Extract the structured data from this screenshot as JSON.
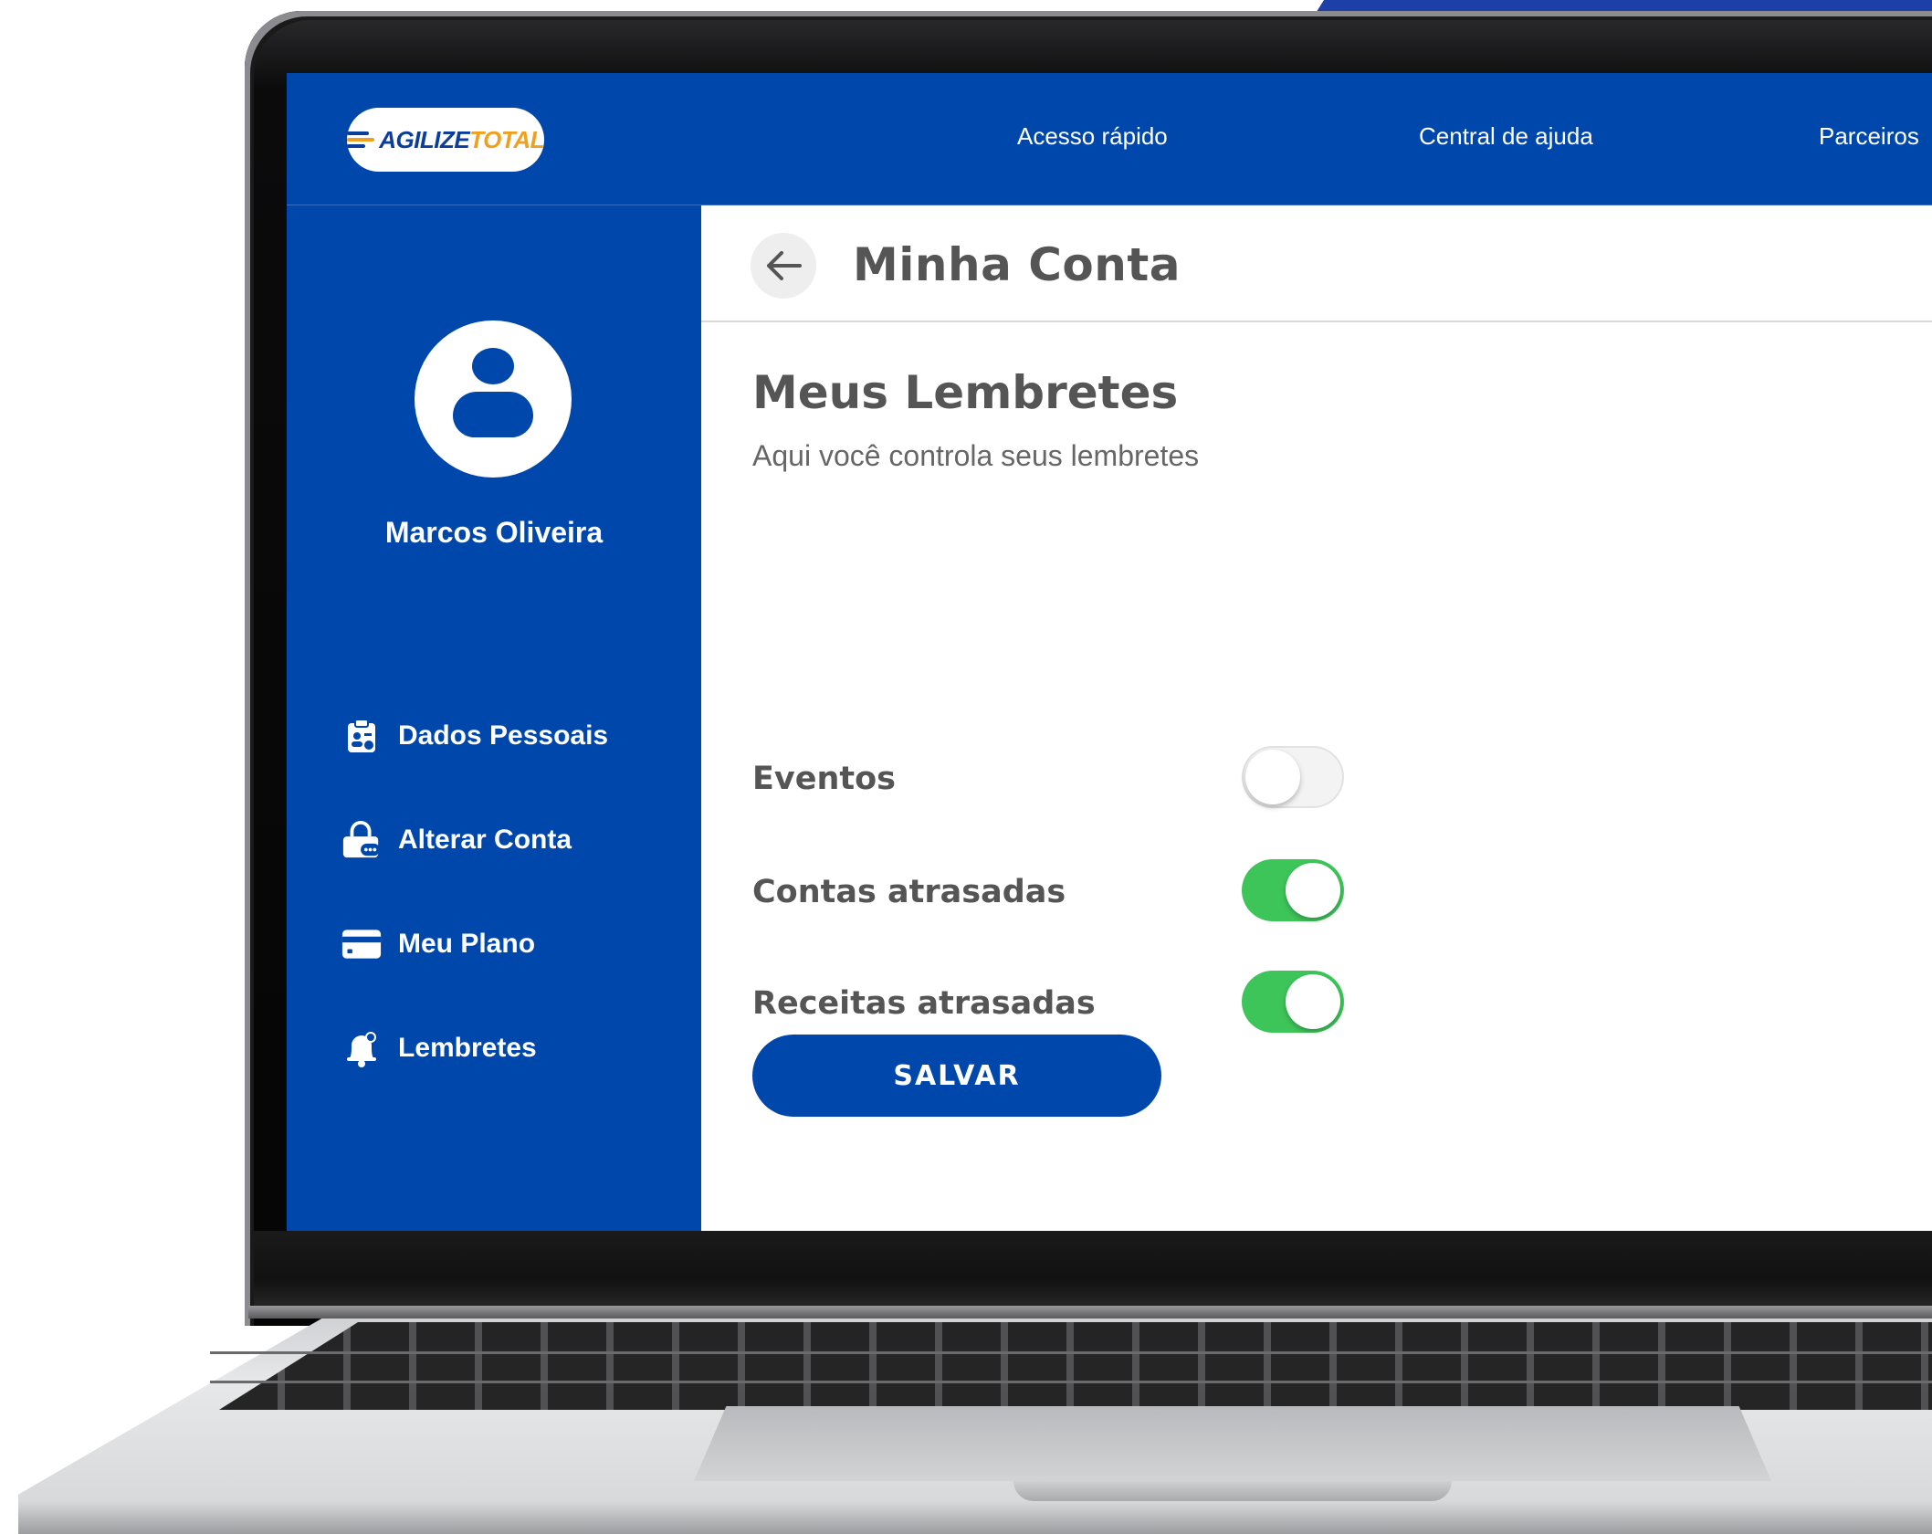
{
  "brand": {
    "logo_text": "AGILIZE",
    "logo_text_accent": "TOTAL"
  },
  "topnav": {
    "items": [
      {
        "label": "Acesso rápido"
      },
      {
        "label": "Central de ajuda"
      },
      {
        "label": "Parceiros"
      }
    ]
  },
  "sidebar": {
    "user_name": "Marcos Oliveira",
    "items": [
      {
        "label": "Dados Pessoais",
        "icon": "clipboard-user-icon"
      },
      {
        "label": "Alterar Conta",
        "icon": "lock-edit-icon"
      },
      {
        "label": "Meu Plano",
        "icon": "credit-card-icon"
      },
      {
        "label": "Lembretes",
        "icon": "bell-icon"
      }
    ]
  },
  "page": {
    "title": "Minha Conta",
    "section_title": "Meus Lembretes",
    "section_subtitle": "Aqui você controla seus lembretes"
  },
  "settings": [
    {
      "label": "Eventos",
      "enabled": false
    },
    {
      "label": "Contas atrasadas",
      "enabled": true
    },
    {
      "label": "Receitas atrasadas",
      "enabled": true
    }
  ],
  "actions": {
    "save_label": "SALVAR"
  },
  "colors": {
    "primary": "#0047ab",
    "toggle_on": "#3ec55a",
    "logo_accent": "#f0a020",
    "text_dark": "#555555"
  }
}
